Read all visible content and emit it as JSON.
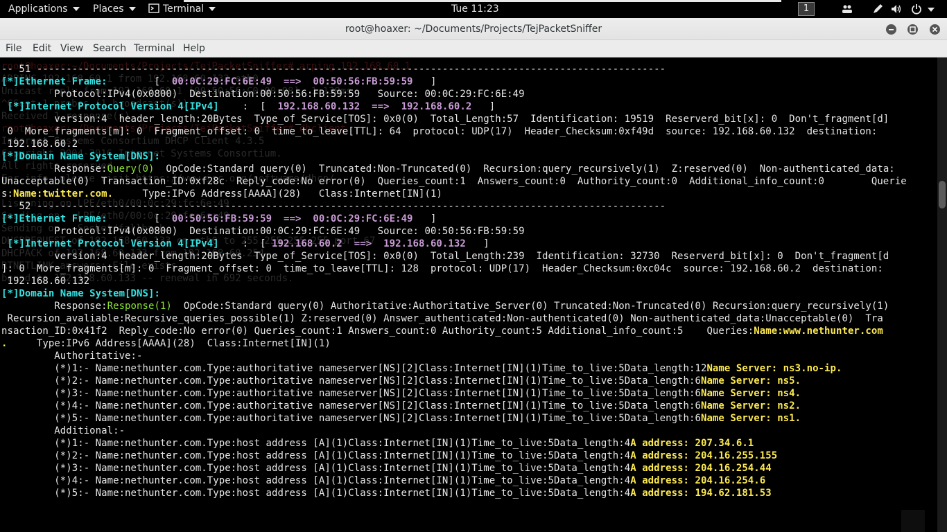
{
  "topbar": {
    "applications": "Applications",
    "places": "Places",
    "terminal": "Terminal",
    "clock": "Tue 11:23",
    "workspace": "1",
    "icons": [
      "users-icon",
      "pen-icon",
      "volume-icon",
      "power-icon"
    ]
  },
  "window": {
    "title": "root@hoaxer: ~/Documents/Projects/TejPacketSniffer",
    "buttons": [
      "minimize-icon",
      "maximize-icon",
      "close-icon"
    ]
  },
  "menubar": [
    "File",
    "Edit",
    "View",
    "Search",
    "Terminal",
    "Help"
  ],
  "background_text": [
    "root@hoaxer:~/Documents/Projects/TejPacketSniffer# arping 192.168.60.1",
    "ARPING 192.168.60.1 from 192.168.60.132 eth0",
    "Unicast reply from 192.168.60.1 [00:50:56:C0:00:08]  1.138ms",
    "^CSent 1 probes (1 broadcast(s))",
    "Received 1 response(s)",
    "root@hoaxer:~/Documents/Projects/TejPacketSniffer# dhclient",
    "Internet Systems Consortium DHCP Client 4.3.5",
    "Copyright 2004-2016 Internet Systems Consortium.",
    "All rights reserved.",
    "For info, please visit https://www.isc.org/software/dhcp/",
    "",
    "Listening on LPF/eth0/00:0c:29:fc:6e:49",
    "Sending on   LPF/eth0/00:0c:29:fc:6e:49",
    "Sending on   Socket/fallback",
    "DHCPREQUEST of 192.168.60.133 on eth0 to 255.255.255.255 port 67",
    "DHCPACK of 192.168.60.133 from 192.168.60.254",
    "RTNETLINK answers: File exists",
    "bound to 192.168.60.133 -- renewal in 692 seconds."
  ],
  "terminal": {
    "lines": [
      [
        {
          "t": "-- 51 -----------------------------------------------------------------------------------------------------------",
          "c": "wht"
        }
      ],
      [
        {
          "t": "[*]Ethernet Frame:",
          "c": "cyan"
        },
        {
          "t": "        [  ",
          "c": "wht"
        },
        {
          "t": "00:0C:29:FC:6E:49  ==>  00:50:56:FB:59:59",
          "c": "mag"
        },
        {
          "t": "   ]",
          "c": "wht"
        }
      ],
      [
        {
          "t": "         Protocol:IPv4(0x0800)  Destination:00:50:56:FB:59:59   Source: 00:0C:29:FC:6E:49",
          "c": "wht"
        }
      ],
      [
        {
          "t": " [*]Internet Protocol Version 4[IPv4]",
          "c": "cyan"
        },
        {
          "t": "    :  [  ",
          "c": "wht"
        },
        {
          "t": "192.168.60.132  ==>  192.168.60.2",
          "c": "mag"
        },
        {
          "t": "   ]",
          "c": "wht"
        }
      ],
      [
        {
          "t": "         version:4  header_length:20Bytes  Type_of_Service[TOS]: 0x0(0)  Total_Length:57  Identification: 19519  Reserverd_bit[x]: 0  Don't_fragment[d]",
          "c": "wht"
        }
      ],
      [
        {
          "t": " 0  More_fragments[m]: 0  Fragment_offset: 0  time_to_leave[TTL]: 64  protocol: UDP(17)  Header_Checksum:0xf49d  source: 192.168.60.132  destination:",
          "c": "wht"
        }
      ],
      [
        {
          "t": " 192.168.60.2",
          "c": "wht"
        }
      ],
      [
        {
          "t": "[*]Domain Name System[DNS]:",
          "c": "cyan"
        }
      ],
      [
        {
          "t": "         Response:",
          "c": "wht"
        },
        {
          "t": "Query(0)",
          "c": "grn"
        },
        {
          "t": "  OpCode:Standard query(0)  Truncated:Non-Truncated(0)  Recursion:query_recursively(1)  Z:reserved(0)  Non-authenticated_data:",
          "c": "wht"
        }
      ],
      [
        {
          "t": "Unacceptable(0)  Transaction_ID:0xf28c  Reply_code:No error(0)  Queries_count:1  Answers_count:0  Authority_count:0  Additional_info_count:0        Querie",
          "c": "wht"
        }
      ],
      [
        {
          "t": "s:",
          "c": "wht"
        },
        {
          "t": "Name:twitter.com.",
          "c": "yel"
        },
        {
          "t": "     Type:IPv6 Address[AAAA](28)   Class:Internet[IN](1)",
          "c": "wht"
        }
      ],
      [
        {
          "t": "-- 52 -----------------------------------------------------------------------------------------------------------",
          "c": "wht"
        }
      ],
      [
        {
          "t": "[*]Ethernet Frame:",
          "c": "cyan"
        },
        {
          "t": "        [  ",
          "c": "wht"
        },
        {
          "t": "00:50:56:FB:59:59  ==>  00:0C:29:FC:6E:49",
          "c": "mag"
        },
        {
          "t": "   ]",
          "c": "wht"
        }
      ],
      [
        {
          "t": "         Protocol:IPv4(0x0800)  Destination:00:0C:29:FC:6E:49   Source: 00:50:56:FB:59:59",
          "c": "wht"
        }
      ],
      [
        {
          "t": " [*]Internet Protocol Version 4[IPv4]",
          "c": "cyan"
        },
        {
          "t": "    :  [ ",
          "c": "wht"
        },
        {
          "t": "192.168.60.2  ==>  192.168.60.132",
          "c": "mag"
        },
        {
          "t": "   ]",
          "c": "wht"
        }
      ],
      [
        {
          "t": "         version:4  header_length:20Bytes  Type_of_Service[TOS]: 0x0(0)  Total_Length:239  Identification: 32730  Reserverd_bit[x]: 0  Don't_fragment[d",
          "c": "wht"
        }
      ],
      [
        {
          "t": "]: 0  More_fragments[m]: 0  Fragment_offset: 0  time_to_leave[TTL]: 128  protocol: UDP(17)  Header_Checksum:0xc04c  source: 192.168.60.2  destination:",
          "c": "wht"
        }
      ],
      [
        {
          "t": " 192.168.60.132",
          "c": "wht"
        }
      ],
      [
        {
          "t": "[*]Domain Name System[DNS]:",
          "c": "cyan"
        }
      ],
      [
        {
          "t": "         Response:",
          "c": "wht"
        },
        {
          "t": "Response(1)",
          "c": "grn"
        },
        {
          "t": "  OpCode:Standard query(0) Authoritative:Authoritative_Server(0) Truncated:Non-Truncated(0) Recursion:query_recursively(1)",
          "c": "wht"
        }
      ],
      [
        {
          "t": " Recursion_avaliable:Recursive_queries_possible(1) Z:reserved(0) Answer_authenticated:Non-authenticated(0) Non-authenticated_data:Unacceptable(0)  Tra",
          "c": "wht"
        }
      ],
      [
        {
          "t": "nsaction_ID:0x41f2  Reply_code:No error(0) Queries_count:1 Answers_count:0 Authority_count:5 Additional_info_count:5    Queries:",
          "c": "wht"
        },
        {
          "t": "Name:www.nethunter.com",
          "c": "yel"
        }
      ],
      [
        {
          "t": ".",
          "c": "yel"
        },
        {
          "t": "     Type:IPv6 Address[AAAA](28)  Class:Internet[IN](1)",
          "c": "wht"
        }
      ],
      [
        {
          "t": "         Authoritative:-",
          "c": "wht"
        }
      ],
      [
        {
          "t": "         (*)1:- Name:nethunter.com.Type:authoritative nameserver[NS][2]Class:Internet[IN](1)Time_to_live:5Data_length:12",
          "c": "wht"
        },
        {
          "t": "Name Server: ns3.no-ip.",
          "c": "yel"
        }
      ],
      [
        {
          "t": "         (*)2:- Name:nethunter.com.Type:authoritative nameserver[NS][2]Class:Internet[IN](1)Time_to_live:5Data_length:6",
          "c": "wht"
        },
        {
          "t": "Name Server: ns5.",
          "c": "yel"
        }
      ],
      [
        {
          "t": "         (*)3:- Name:nethunter.com.Type:authoritative nameserver[NS][2]Class:Internet[IN](1)Time_to_live:5Data_length:6",
          "c": "wht"
        },
        {
          "t": "Name Server: ns4.",
          "c": "yel"
        }
      ],
      [
        {
          "t": "         (*)4:- Name:nethunter.com.Type:authoritative nameserver[NS][2]Class:Internet[IN](1)Time_to_live:5Data_length:6",
          "c": "wht"
        },
        {
          "t": "Name Server: ns2.",
          "c": "yel"
        }
      ],
      [
        {
          "t": "         (*)5:- Name:nethunter.com.Type:authoritative nameserver[NS][2]Class:Internet[IN](1)Time_to_live:5Data_length:6",
          "c": "wht"
        },
        {
          "t": "Name Server: ns1.",
          "c": "yel"
        }
      ],
      [
        {
          "t": "         Additional:-",
          "c": "wht"
        }
      ],
      [
        {
          "t": "         (*)1:- Name:nethunter.com.Type:host address [A](1)Class:Internet[IN](1)Time_to_live:5Data_length:4",
          "c": "wht"
        },
        {
          "t": "A address: 207.34.6.1",
          "c": "yel"
        }
      ],
      [
        {
          "t": "         (*)2:- Name:nethunter.com.Type:host address [A](1)Class:Internet[IN](1)Time_to_live:5Data_length:4",
          "c": "wht"
        },
        {
          "t": "A address: 204.16.255.155",
          "c": "yel"
        }
      ],
      [
        {
          "t": "         (*)3:- Name:nethunter.com.Type:host address [A](1)Class:Internet[IN](1)Time_to_live:5Data_length:4",
          "c": "wht"
        },
        {
          "t": "A address: 204.16.254.44",
          "c": "yel"
        }
      ],
      [
        {
          "t": "         (*)4:- Name:nethunter.com.Type:host address [A](1)Class:Internet[IN](1)Time_to_live:5Data_length:4",
          "c": "wht"
        },
        {
          "t": "A address: 204.16.254.6",
          "c": "yel"
        }
      ],
      [
        {
          "t": "         (*)5:- Name:nethunter.com.Type:host address [A](1)Class:Internet[IN](1)Time_to_live:5Data_length:4",
          "c": "wht"
        },
        {
          "t": "A address: 194.62.181.53",
          "c": "yel"
        }
      ]
    ]
  }
}
